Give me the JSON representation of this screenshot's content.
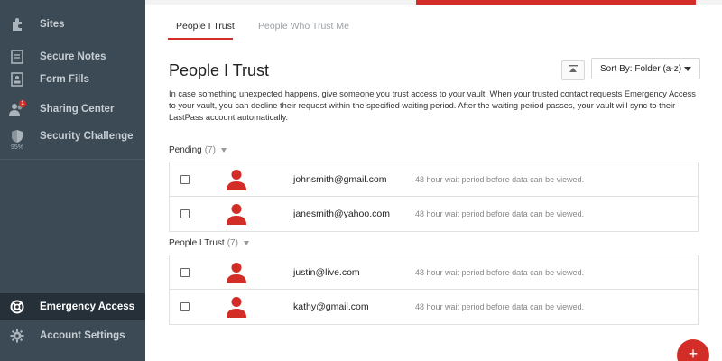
{
  "sidebar": {
    "items": [
      {
        "label": "Sites",
        "icon": "puzzle-icon"
      },
      {
        "label": "Secure Notes",
        "icon": "note-icon"
      },
      {
        "label": "Form Fills",
        "icon": "form-icon"
      },
      {
        "label": "Sharing Center",
        "icon": "sharing-icon",
        "badge": "1"
      },
      {
        "label": "Security Challenge",
        "icon": "shield-icon",
        "sub": "95%"
      },
      {
        "label": "Emergency Access",
        "icon": "lifebuoy-icon"
      },
      {
        "label": "Account Settings",
        "icon": "gear-icon"
      }
    ]
  },
  "tabs": [
    {
      "label": "People I Trust",
      "active": true
    },
    {
      "label": "People Who Trust Me",
      "active": false
    }
  ],
  "main": {
    "title": "People I Trust",
    "description": "In case something unexpected happens, give someone you trust access to your vault. When your trusted contact requests Emergency Access to your vault, you can decline their request within the specified waiting period. After the waiting period passes, your vault will sync to their LastPass account automatically.",
    "sort_label": "Sort By: Folder (a-z)"
  },
  "sections": [
    {
      "title": "Pending",
      "count": "(7)",
      "rows": [
        {
          "email": "johnsmith@gmail.com",
          "wait": "48 hour wait period before data can be viewed."
        },
        {
          "email": "janesmith@yahoo.com",
          "wait": "48 hour wait period before data can be viewed."
        }
      ]
    },
    {
      "title": "People I Trust",
      "count": "(7)",
      "rows": [
        {
          "email": "justin@live.com",
          "wait": "48 hour wait period before data can be viewed."
        },
        {
          "email": "kathy@gmail.com",
          "wait": "48 hour wait period before data can be viewed."
        }
      ]
    }
  ],
  "fab": {
    "label": "+"
  },
  "colors": {
    "accent": "#d32d27",
    "sidebar": "#3c4a55",
    "sidebar_active": "#253038"
  }
}
